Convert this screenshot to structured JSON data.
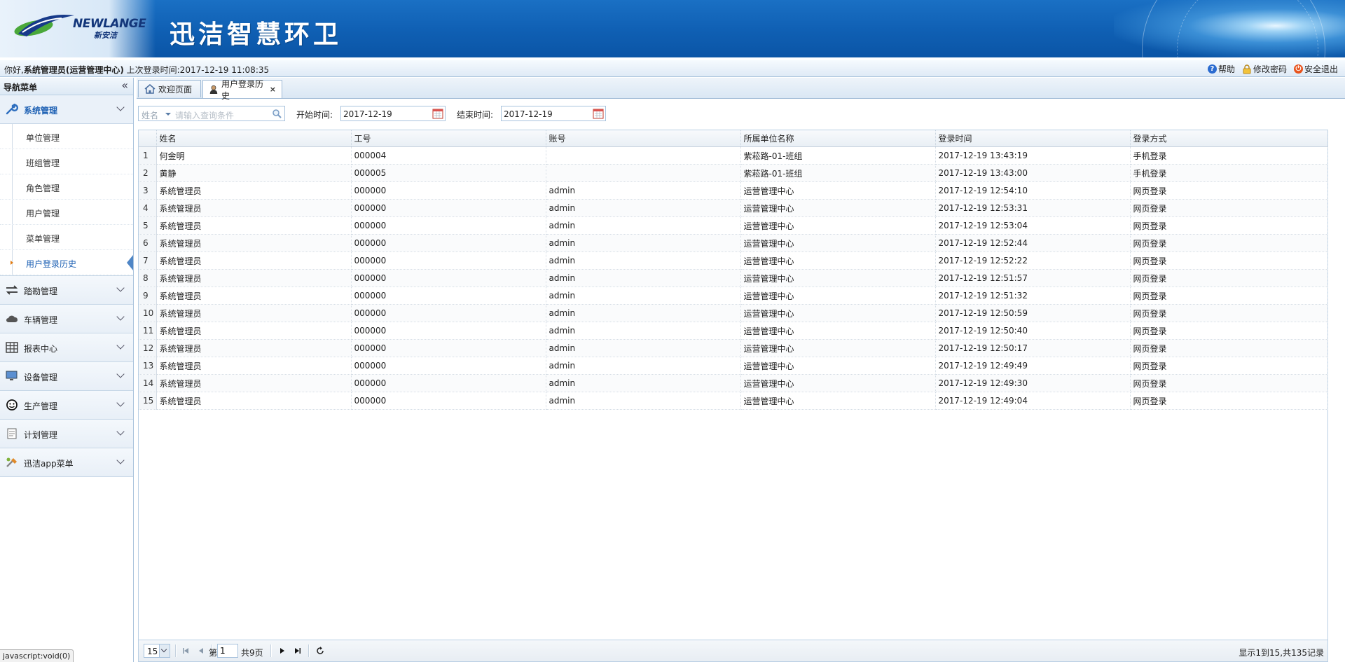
{
  "header": {
    "logo_en": "NEWLANGE",
    "logo_cn": "新安洁",
    "app_title": "迅洁智慧环卫"
  },
  "infobar": {
    "greeting_prefix": "你好,",
    "user_info": "系统管理员(运营管理中心)",
    "last_login": "上次登录时间:2017-12-19 11:08:35",
    "links": [
      {
        "label": "帮助",
        "icon": "help-icon"
      },
      {
        "label": "修改密码",
        "icon": "lock-icon"
      },
      {
        "label": "安全退出",
        "icon": "power-icon"
      }
    ]
  },
  "sidebar": {
    "title": "导航菜单",
    "collapse_glyph": "«",
    "groups": [
      {
        "label": "系统管理",
        "icon": "wrench-icon",
        "expanded": true
      },
      {
        "label": "踏勘管理",
        "icon": "transfer-icon"
      },
      {
        "label": "车辆管理",
        "icon": "cloud-icon"
      },
      {
        "label": "报表中心",
        "icon": "table-icon"
      },
      {
        "label": "设备管理",
        "icon": "monitor-icon"
      },
      {
        "label": "生产管理",
        "icon": "face-icon"
      },
      {
        "label": "计划管理",
        "icon": "document-icon"
      },
      {
        "label": "迅洁app菜单",
        "icon": "tools-icon"
      }
    ],
    "sub_items": [
      "单位管理",
      "班组管理",
      "角色管理",
      "用户管理",
      "菜单管理",
      "用户登录历史"
    ],
    "active_sub_index": 5
  },
  "tabs": [
    {
      "label": "欢迎页面",
      "icon": "home-icon",
      "active": false
    },
    {
      "label": "用户登录历史",
      "icon": "user-icon",
      "active": true,
      "close": "×"
    }
  ],
  "toolbar": {
    "search_field": "姓名",
    "search_placeholder": "请输入查询条件",
    "start_label": "开始时间:",
    "start_value": "2017-12-19",
    "end_label": "结束时间:",
    "end_value": "2017-12-19"
  },
  "table": {
    "columns": [
      "姓名",
      "工号",
      "账号",
      "所属单位名称",
      "登录时间",
      "登录方式"
    ],
    "rows": [
      [
        "1",
        "何金明",
        "000004",
        "",
        "紫菘路-01-班组",
        "2017-12-19 13:43:19",
        "手机登录"
      ],
      [
        "2",
        "黄静",
        "000005",
        "",
        "紫菘路-01-班组",
        "2017-12-19 13:43:00",
        "手机登录"
      ],
      [
        "3",
        "系统管理员",
        "000000",
        "admin",
        "运营管理中心",
        "2017-12-19 12:54:10",
        "网页登录"
      ],
      [
        "4",
        "系统管理员",
        "000000",
        "admin",
        "运营管理中心",
        "2017-12-19 12:53:31",
        "网页登录"
      ],
      [
        "5",
        "系统管理员",
        "000000",
        "admin",
        "运营管理中心",
        "2017-12-19 12:53:04",
        "网页登录"
      ],
      [
        "6",
        "系统管理员",
        "000000",
        "admin",
        "运营管理中心",
        "2017-12-19 12:52:44",
        "网页登录"
      ],
      [
        "7",
        "系统管理员",
        "000000",
        "admin",
        "运营管理中心",
        "2017-12-19 12:52:22",
        "网页登录"
      ],
      [
        "8",
        "系统管理员",
        "000000",
        "admin",
        "运营管理中心",
        "2017-12-19 12:51:57",
        "网页登录"
      ],
      [
        "9",
        "系统管理员",
        "000000",
        "admin",
        "运营管理中心",
        "2017-12-19 12:51:32",
        "网页登录"
      ],
      [
        "10",
        "系统管理员",
        "000000",
        "admin",
        "运营管理中心",
        "2017-12-19 12:50:59",
        "网页登录"
      ],
      [
        "11",
        "系统管理员",
        "000000",
        "admin",
        "运营管理中心",
        "2017-12-19 12:50:40",
        "网页登录"
      ],
      [
        "12",
        "系统管理员",
        "000000",
        "admin",
        "运营管理中心",
        "2017-12-19 12:50:17",
        "网页登录"
      ],
      [
        "13",
        "系统管理员",
        "000000",
        "admin",
        "运营管理中心",
        "2017-12-19 12:49:49",
        "网页登录"
      ],
      [
        "14",
        "系统管理员",
        "000000",
        "admin",
        "运营管理中心",
        "2017-12-19 12:49:30",
        "网页登录"
      ],
      [
        "15",
        "系统管理员",
        "000000",
        "admin",
        "运营管理中心",
        "2017-12-19 12:49:04",
        "网页登录"
      ]
    ]
  },
  "pager": {
    "page_size": "15",
    "page_prefix": "第",
    "page_value": "1",
    "page_total": "共9页",
    "info": "显示1到15,共135记录"
  },
  "status_bar": "javascript:void(0)",
  "colors": {
    "banner_blue": "#0f5fb3",
    "accent_link": "#1b5fb3",
    "active_marker": "#e07b12"
  }
}
